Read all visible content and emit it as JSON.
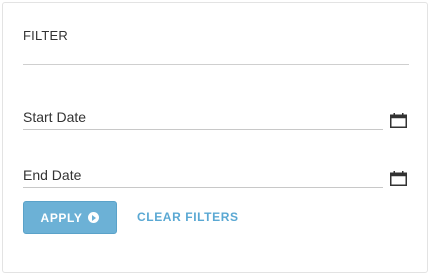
{
  "filter": {
    "title": "FILTER",
    "start_date": {
      "label": "Start Date",
      "value": "",
      "icon": "calendar-icon"
    },
    "end_date": {
      "label": "End Date",
      "value": "",
      "icon": "calendar-icon"
    },
    "apply_label": "APPLY",
    "apply_icon": "play-circle-icon",
    "clear_label": "CLEAR FILTERS"
  },
  "colors": {
    "accent": "#6cb1d6",
    "link": "#5aa8d3",
    "text": "#333333",
    "border": "#e3e3e3"
  }
}
